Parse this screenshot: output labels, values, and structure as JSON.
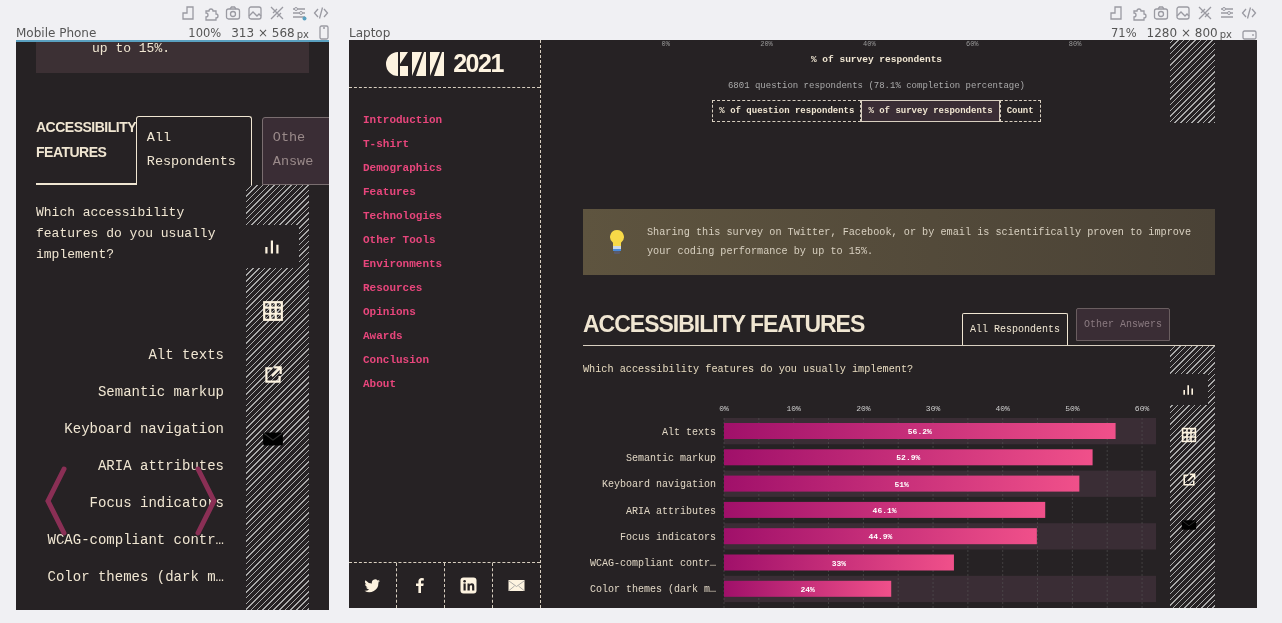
{
  "mobile": {
    "label": "Mobile Phone",
    "zoom": "100%",
    "size": "313 × 568",
    "unit": "px",
    "tip_text": "up to 15%.",
    "section": {
      "title": "ACCESSIBILITY FEATURES",
      "tabs": [
        {
          "label": "All Respondents",
          "selected": true
        },
        {
          "label": "Othe Answe",
          "selected": false
        }
      ],
      "question": "Which accessibility features do you usually implement?",
      "views": [
        {
          "kind": "chart",
          "selected": true
        },
        {
          "kind": "table",
          "selected": false
        }
      ],
      "bar_labels": [
        "Alt texts",
        "Semantic markup",
        "Keyboard navigation",
        "ARIA attributes",
        "Focus indicators",
        "WCAG-compliant contr…",
        "Color themes (dark m…"
      ]
    }
  },
  "laptop": {
    "label": "Laptop",
    "zoom": "71%",
    "size": "1280 × 800",
    "unit": "px",
    "logo_text": "2021",
    "nav": [
      "Introduction",
      "T-shirt",
      "Demographics",
      "Features",
      "Technologies",
      "Other Tools",
      "Environments",
      "Resources",
      "Opinions",
      "Awards",
      "Conclusion",
      "About"
    ],
    "prev_chart": {
      "ticks": [
        "0%",
        "20%",
        "40%",
        "60%",
        "80%"
      ],
      "xlabel": "% of survey respondents",
      "respondents": "6801 question respondents (78.1% completion percentage)",
      "units": [
        {
          "label": "% of question respondents",
          "selected": false
        },
        {
          "label": "% of survey respondents",
          "selected": true
        },
        {
          "label": "Count",
          "selected": false
        }
      ]
    },
    "tip": "Sharing this survey on Twitter, Facebook, or by email is scientifically proven to improve your coding performance by up to 15%.",
    "section": {
      "title": "ACCESSIBILITY FEATURES",
      "tabs": [
        {
          "label": "All Respondents",
          "selected": true
        },
        {
          "label": "Other Answers",
          "selected": false
        }
      ],
      "question": "Which accessibility features do you usually implement?",
      "views": [
        {
          "kind": "chart",
          "selected": true
        },
        {
          "kind": "table",
          "selected": false
        }
      ],
      "chart_data": {
        "type": "bar",
        "orientation": "horizontal",
        "categories": [
          "Alt texts",
          "Semantic markup",
          "Keyboard navigation",
          "ARIA attributes",
          "Focus indicators",
          "WCAG-compliant contr…",
          "Color themes (dark m…"
        ],
        "values": [
          56.2,
          52.9,
          51,
          46.1,
          44.9,
          33,
          24
        ],
        "value_labels": [
          "56.2%",
          "52.9%",
          "51%",
          "46.1%",
          "44.9%",
          "33%",
          "24%"
        ],
        "xlim": [
          0,
          62
        ],
        "grid": true,
        "xticks": [
          {
            "value": 0,
            "label": "0%"
          },
          {
            "value": 10,
            "label": "10%"
          },
          {
            "value": 20,
            "label": "20%"
          },
          {
            "value": 30,
            "label": "30%"
          },
          {
            "value": 40,
            "label": "40%"
          },
          {
            "value": 50,
            "label": "50%"
          },
          {
            "value": 60,
            "label": "60%"
          }
        ]
      }
    }
  }
}
